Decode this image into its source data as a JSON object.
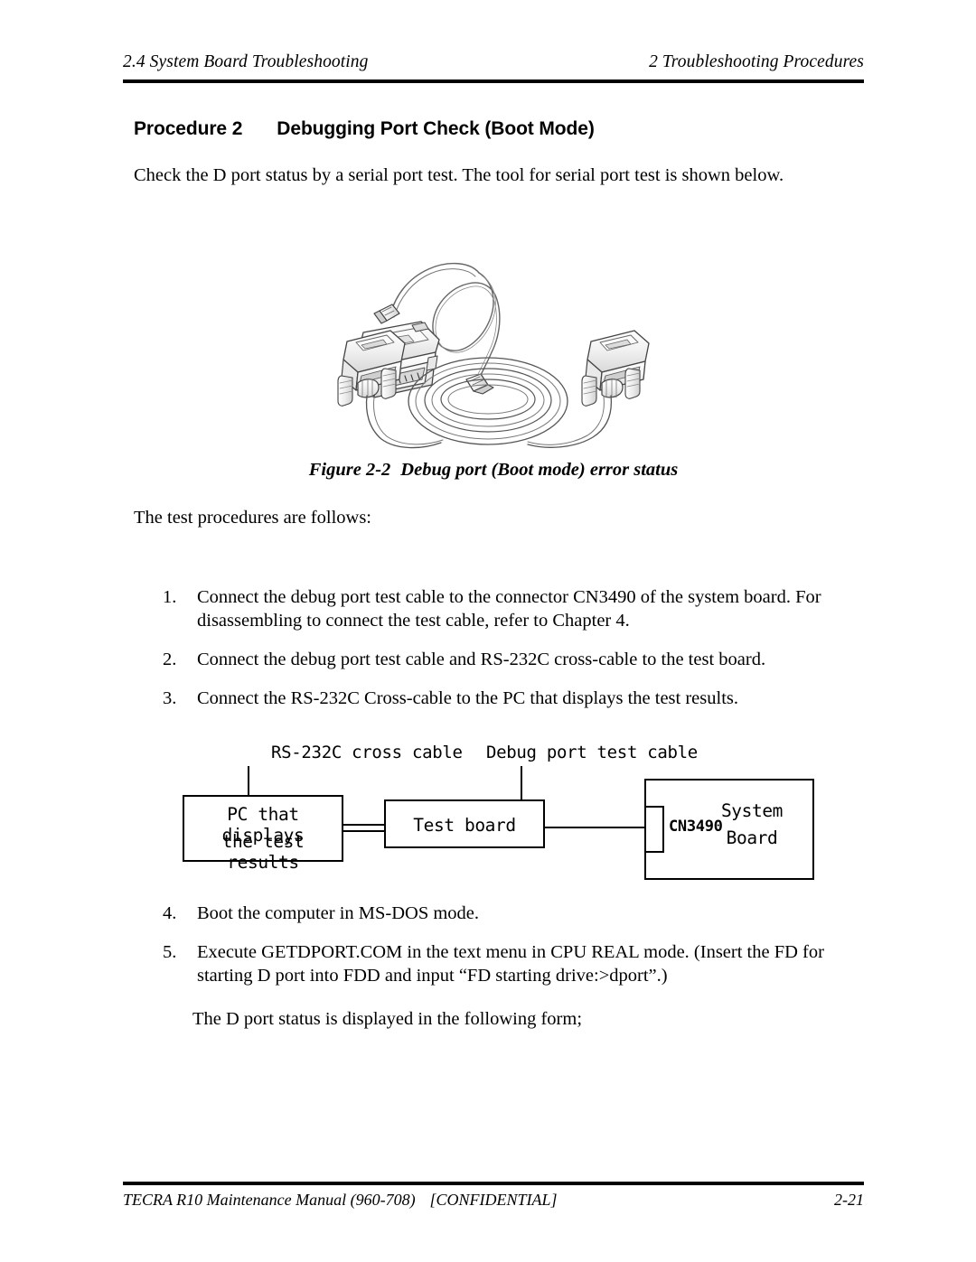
{
  "header": {
    "left": "2.4 System Board Troubleshooting",
    "right": "2  Troubleshooting Procedures"
  },
  "heading": {
    "label": "Procedure 2",
    "title": "Debugging Port Check (Boot Mode)"
  },
  "intro": "Check the D port status by a serial port test. The tool for serial port test is shown below.",
  "figure": {
    "caption_number": "Figure 2-2",
    "caption_text": "Debug port (Boot mode) error status",
    "alt": "line drawing of debug port test cable, RS-232C cross cable and DB9 adapter"
  },
  "follows_text": "The test procedures are follows:",
  "steps_a": [
    {
      "num": "1.",
      "text": "Connect the debug port test cable to the connector CN3490 of the system board. For disassembling to connect the test cable, refer to Chapter 4."
    },
    {
      "num": "2.",
      "text": "Connect the debug port test cable and RS-232C cross-cable to the test board."
    },
    {
      "num": "3.",
      "text": "Connect the RS-232C Cross-cable to the PC that displays the test results."
    }
  ],
  "diagram": {
    "label_cross_cable": "RS-232C cross cable",
    "label_debug_cable": "Debug port test cable",
    "pc_box_line1": "PC that displays",
    "pc_box_line2": "the test results",
    "test_board": "Test board",
    "connector": "CN3490",
    "system_board_line1": "System",
    "system_board_line2": "Board"
  },
  "steps_b": [
    {
      "num": "4.",
      "text": "Boot the computer in MS-DOS mode."
    },
    {
      "num": "5.",
      "text": "Execute GETDPORT.COM in the text menu in CPU REAL mode. (Insert the FD for starting D port into FDD and input “FD starting drive:>dport”.)"
    }
  ],
  "dport_note": "The D port status is displayed in the following form;",
  "footer": {
    "left": "TECRA R10 Maintenance Manual (960-708)",
    "center": "[CONFIDENTIAL]",
    "right": "2-21"
  }
}
